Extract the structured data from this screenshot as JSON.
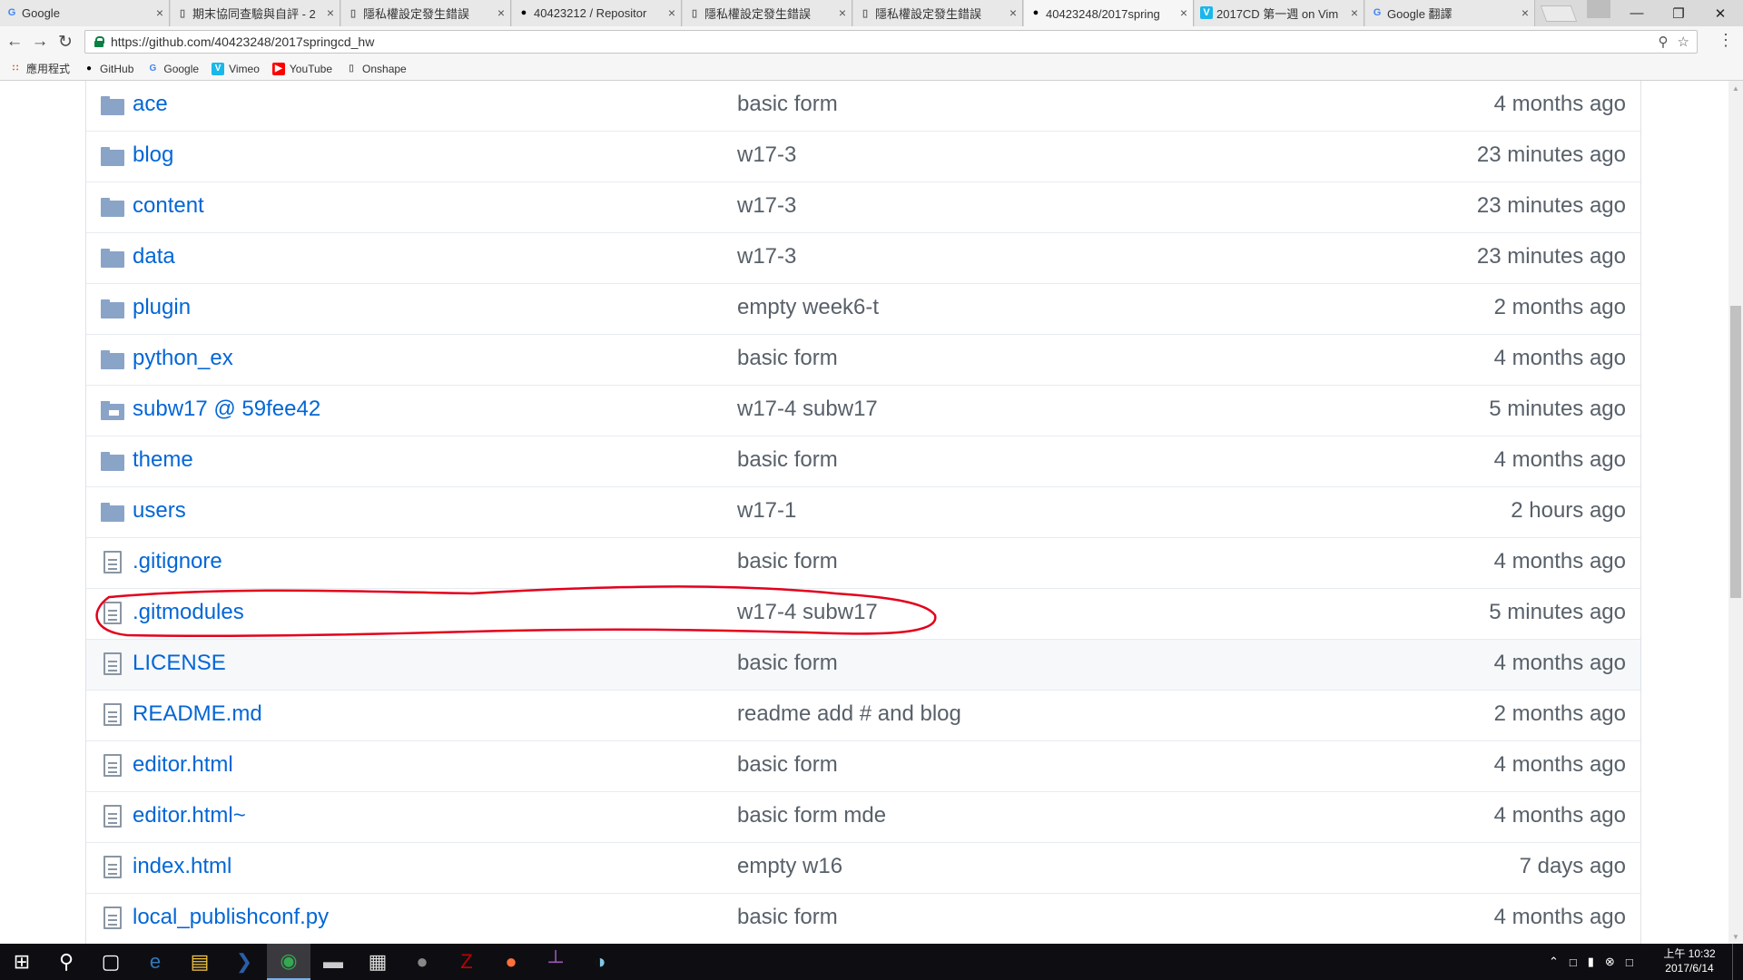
{
  "browser": {
    "tabs": [
      {
        "title": "Google",
        "icon": "google-g-icon",
        "icon_color": "#4285f4",
        "active": false
      },
      {
        "title": "期末協同查驗與自評 - 2",
        "icon": "doc-icon",
        "icon_color": "#666666",
        "active": false
      },
      {
        "title": "隱私權設定發生錯誤",
        "icon": "doc-icon",
        "icon_color": "#666666",
        "active": false
      },
      {
        "title": "40423212 / Repositor",
        "icon": "github-icon",
        "icon_color": "#000000",
        "active": false
      },
      {
        "title": "隱私權設定發生錯誤",
        "icon": "doc-icon",
        "icon_color": "#666666",
        "active": false
      },
      {
        "title": "隱私權設定發生錯誤",
        "icon": "doc-icon",
        "icon_color": "#666666",
        "active": false
      },
      {
        "title": "40423248/2017spring",
        "icon": "github-icon",
        "icon_color": "#000000",
        "active": true
      },
      {
        "title": "2017CD 第一週 on Vim",
        "icon": "vimeo-icon",
        "icon_color": "#1ab7ea",
        "active": false
      },
      {
        "title": "Google 翻譯",
        "icon": "translate-icon",
        "icon_color": "#4285f4",
        "active": false
      }
    ],
    "close_glyph": "×",
    "address": {
      "url": "https://github.com/40423248/2017springcd_hw"
    },
    "bookmarks": [
      {
        "label": "應用程式",
        "icon": "apps-grid-icon",
        "color": "#d93025"
      },
      {
        "label": "GitHub",
        "icon": "github-icon",
        "color": "#000000"
      },
      {
        "label": "Google",
        "icon": "google-g-icon",
        "color": "#4285f4"
      },
      {
        "label": "Vimeo",
        "icon": "vimeo-icon",
        "color": "#1ab7ea"
      },
      {
        "label": "YouTube",
        "icon": "youtube-icon",
        "color": "#ff0000"
      },
      {
        "label": "Onshape",
        "icon": "doc-icon",
        "color": "#666666"
      }
    ]
  },
  "files": [
    {
      "name": "ace",
      "type": "folder",
      "message": "basic form",
      "age": "4 months ago"
    },
    {
      "name": "blog",
      "type": "folder",
      "message": "w17-3",
      "age": "23 minutes ago"
    },
    {
      "name": "content",
      "type": "folder",
      "message": "w17-3",
      "age": "23 minutes ago"
    },
    {
      "name": "data",
      "type": "folder",
      "message": "w17-3",
      "age": "23 minutes ago"
    },
    {
      "name": "plugin",
      "type": "folder",
      "message": "empty week6-t",
      "age": "2 months ago"
    },
    {
      "name": "python_ex",
      "type": "folder",
      "message": "basic form",
      "age": "4 months ago"
    },
    {
      "name": "subw17 @ 59fee42",
      "type": "submodule",
      "message": "w17-4 subw17",
      "age": "5 minutes ago"
    },
    {
      "name": "theme",
      "type": "folder",
      "message": "basic form",
      "age": "4 months ago"
    },
    {
      "name": "users",
      "type": "folder",
      "message": "w17-1",
      "age": "2 hours ago"
    },
    {
      "name": ".gitignore",
      "type": "file",
      "message": "basic form",
      "age": "4 months ago"
    },
    {
      "name": ".gitmodules",
      "type": "file",
      "message": "w17-4 subw17",
      "age": "5 minutes ago",
      "annotated": true
    },
    {
      "name": "LICENSE",
      "type": "file",
      "message": "basic form",
      "age": "4 months ago",
      "hover": true
    },
    {
      "name": "README.md",
      "type": "file",
      "message": "readme add # and blog",
      "age": "2 months ago"
    },
    {
      "name": "editor.html",
      "type": "file",
      "message": "basic form",
      "age": "4 months ago"
    },
    {
      "name": "editor.html~",
      "type": "file",
      "message": "basic form mde",
      "age": "4 months ago"
    },
    {
      "name": "index.html",
      "type": "file",
      "message": "empty w16",
      "age": "7 days ago"
    },
    {
      "name": "local_publishconf.py",
      "type": "file",
      "message": "basic form",
      "age": "4 months ago"
    }
  ],
  "annotation": {
    "color": "#e3001b"
  },
  "taskbar": {
    "apps": [
      {
        "icon": "windows-start-icon",
        "color": "#ffffff"
      },
      {
        "icon": "search-icon",
        "color": "#ffffff"
      },
      {
        "icon": "task-view-icon",
        "color": "#ffffff"
      },
      {
        "icon": "edge-icon",
        "color": "#3277bc"
      },
      {
        "icon": "file-explorer-icon",
        "color": "#f4c542"
      },
      {
        "icon": "powershell-icon",
        "color": "#2b5ea7"
      },
      {
        "icon": "chrome-icon",
        "color": "#34a853",
        "active": true
      },
      {
        "icon": "terminal-icon",
        "color": "#cccccc"
      },
      {
        "icon": "app-doc-icon",
        "color": "#dddddd"
      },
      {
        "icon": "sphere-app-icon",
        "color": "#888888"
      },
      {
        "icon": "filezilla-icon",
        "color": "#bf0000"
      },
      {
        "icon": "firefox-icon",
        "color": "#ff7139"
      },
      {
        "icon": "tool-app-icon",
        "color": "#9b59b6"
      },
      {
        "icon": "paint-app-icon",
        "color": "#7ec8e3"
      }
    ],
    "clock": {
      "time": "上午 10:32",
      "date": "2017/6/14"
    }
  }
}
